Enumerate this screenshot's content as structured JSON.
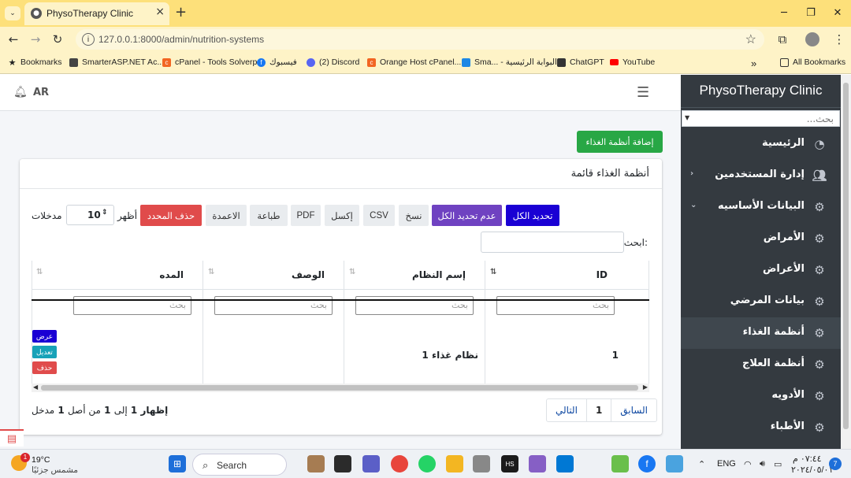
{
  "browser": {
    "tab_title": "PhysoTherapy Clinic",
    "url": "127.0.0.1:8000/admin/nutrition-systems",
    "bookmarks": [
      {
        "label": "Bookmarks",
        "icon": "star-icon",
        "color": "#222222"
      },
      {
        "label": "SmarterASP.NET Ac...",
        "icon": "smarterasp-icon",
        "color": "#444444"
      },
      {
        "label": "cPanel - Tools Solverp",
        "icon": "cpanel-icon",
        "color": "#f26522"
      },
      {
        "label": "فيسبوك",
        "icon": "facebook-icon",
        "color": "#1877f2"
      },
      {
        "label": "(2) Discord",
        "icon": "discord-icon",
        "color": "#5865f2"
      },
      {
        "label": "Orange Host cPanel...",
        "icon": "cpanel-icon",
        "color": "#f26522"
      },
      {
        "label": "Sma... - البوابة الرئيسية",
        "icon": "portal-icon",
        "color": "#1e88e5"
      },
      {
        "label": "ChatGPT",
        "icon": "chatgpt-icon",
        "color": "#333333"
      },
      {
        "label": "YouTube",
        "icon": "youtube-icon",
        "color": "#ff0000"
      }
    ],
    "more_bookmarks": "»",
    "all_bookmarks": "All Bookmarks"
  },
  "topnav": {
    "lang": "AR",
    "bell_icon": "bell-icon",
    "menu_icon": "hamburger-icon"
  },
  "sidebar": {
    "brand": "PhysoTherapy Clinic",
    "search_placeholder": "بحث...",
    "items": [
      {
        "label": "الرئيسية",
        "icon": "dashboard-icon",
        "active": false,
        "chevron": ""
      },
      {
        "label": "إدارة المستخدمين",
        "icon": "users-icon",
        "active": false,
        "chevron": "‹"
      },
      {
        "label": "البيانات الأساسيه",
        "icon": "gears-icon",
        "active": false,
        "chevron": "⌄"
      },
      {
        "label": "الأمراض",
        "icon": "gears-icon",
        "active": false,
        "chevron": ""
      },
      {
        "label": "الأعراض",
        "icon": "gears-icon",
        "active": false,
        "chevron": ""
      },
      {
        "label": "بيانات المرضي",
        "icon": "gears-icon",
        "active": false,
        "chevron": ""
      },
      {
        "label": "أنظمة الغذاء",
        "icon": "gears-icon",
        "active": true,
        "chevron": ""
      },
      {
        "label": "أنظمة العلاج",
        "icon": "gears-icon",
        "active": false,
        "chevron": ""
      },
      {
        "label": "الأدويه",
        "icon": "gears-icon",
        "active": false,
        "chevron": ""
      },
      {
        "label": "الأطباء",
        "icon": "gears-icon",
        "active": false,
        "chevron": ""
      }
    ]
  },
  "page": {
    "add_button": "إضافة أنظمة الغذاء",
    "card_title": "أنظمة الغذاء قائمة",
    "toolbar": {
      "select_all": "تحديد الكل",
      "deselect_all": "عدم تحديد الكل",
      "copy": "نسخ",
      "csv": "CSV",
      "excel": "إكسل",
      "pdf": "PDF",
      "print": "طباعة",
      "columns": "الاعمدة",
      "delete_selected": "حذف المحدد",
      "show_label": "أظهر",
      "page_length": "10",
      "entries_label": "مدخلات"
    },
    "search_label": "ابحث:",
    "table": {
      "columns": [
        "ID",
        "إسم النظام",
        "الوصف",
        "المده"
      ],
      "filter_placeholder": "بحث",
      "rows": [
        {
          "id": "1",
          "name": "نظام غذاء 1",
          "description": "",
          "duration": ""
        }
      ],
      "actions": {
        "view": "عرض",
        "edit": "تعديل",
        "delete": "حذف"
      }
    },
    "info": {
      "prefix": "إظهار",
      "from": "1",
      "to_label": "إلى",
      "to": "1",
      "of_label": "من أصل",
      "total": "1",
      "suffix": "مدخل"
    },
    "pagination": {
      "prev": "السابق",
      "page": "1",
      "next": "التالي"
    }
  },
  "colors": {
    "select_all_btn": "#1a00d4",
    "deselect_all_btn": "#6f42c1",
    "delete_selected_btn": "#e04b4b",
    "add_btn": "#28a745",
    "view_btn": "#1a00d4",
    "edit_btn": "#17a2b8",
    "delete_btn": "#e04b4b",
    "sidebar_bg": "#343a40"
  },
  "taskbar": {
    "weather_badge": "1",
    "temperature": "19°C",
    "weather_desc": "مشمس جزئيًا",
    "search_label": "Search",
    "lang": "ENG",
    "time": "٠٧:٤٤ م",
    "date": "٢٠٢٤/٠٥/٠١",
    "notification_count": "7"
  }
}
